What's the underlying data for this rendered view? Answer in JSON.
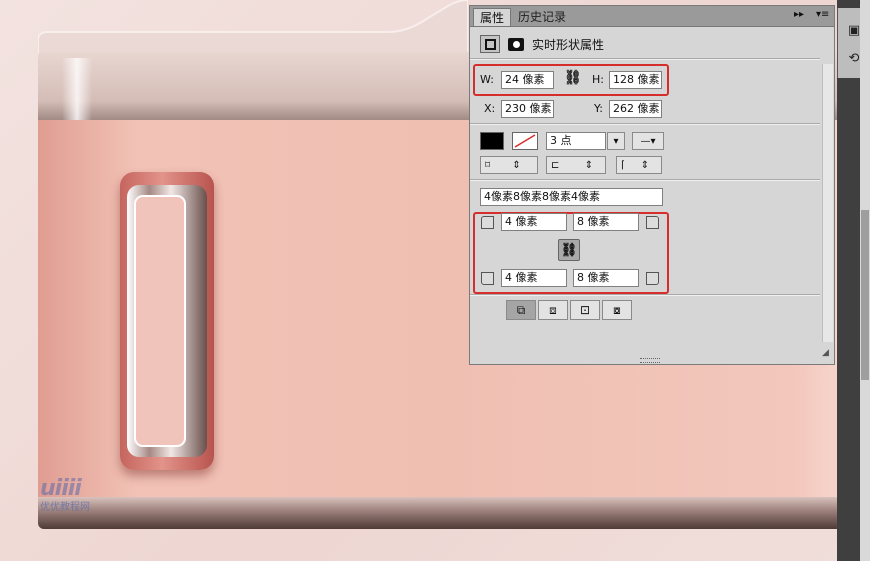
{
  "panel": {
    "tabs": [
      {
        "label": "属性",
        "active": true
      },
      {
        "label": "历史记录",
        "active": false
      }
    ],
    "title": "实时形状属性",
    "size": {
      "w_label": "W:",
      "w_value": "24 像素",
      "h_label": "H:",
      "h_value": "128 像素"
    },
    "position": {
      "x_label": "X:",
      "x_value": "230 像素",
      "y_label": "Y:",
      "y_value": "262 像素"
    },
    "stroke": {
      "fill_color": "#000000",
      "width_value": "3 点"
    },
    "corner_radii": {
      "combined_value": "4像素8像素8像素4像素",
      "top_left": "4 像素",
      "top_right": "8 像素",
      "bottom_left": "4 像素",
      "bottom_right": "8 像素"
    }
  },
  "watermark": {
    "logo": "uiiii",
    "subtitle": "优优教程网"
  },
  "colors": {
    "highlight_red": "#d62d2d",
    "panel_bg": "#d6d6d6",
    "folder_pink": "#efbfb2"
  }
}
